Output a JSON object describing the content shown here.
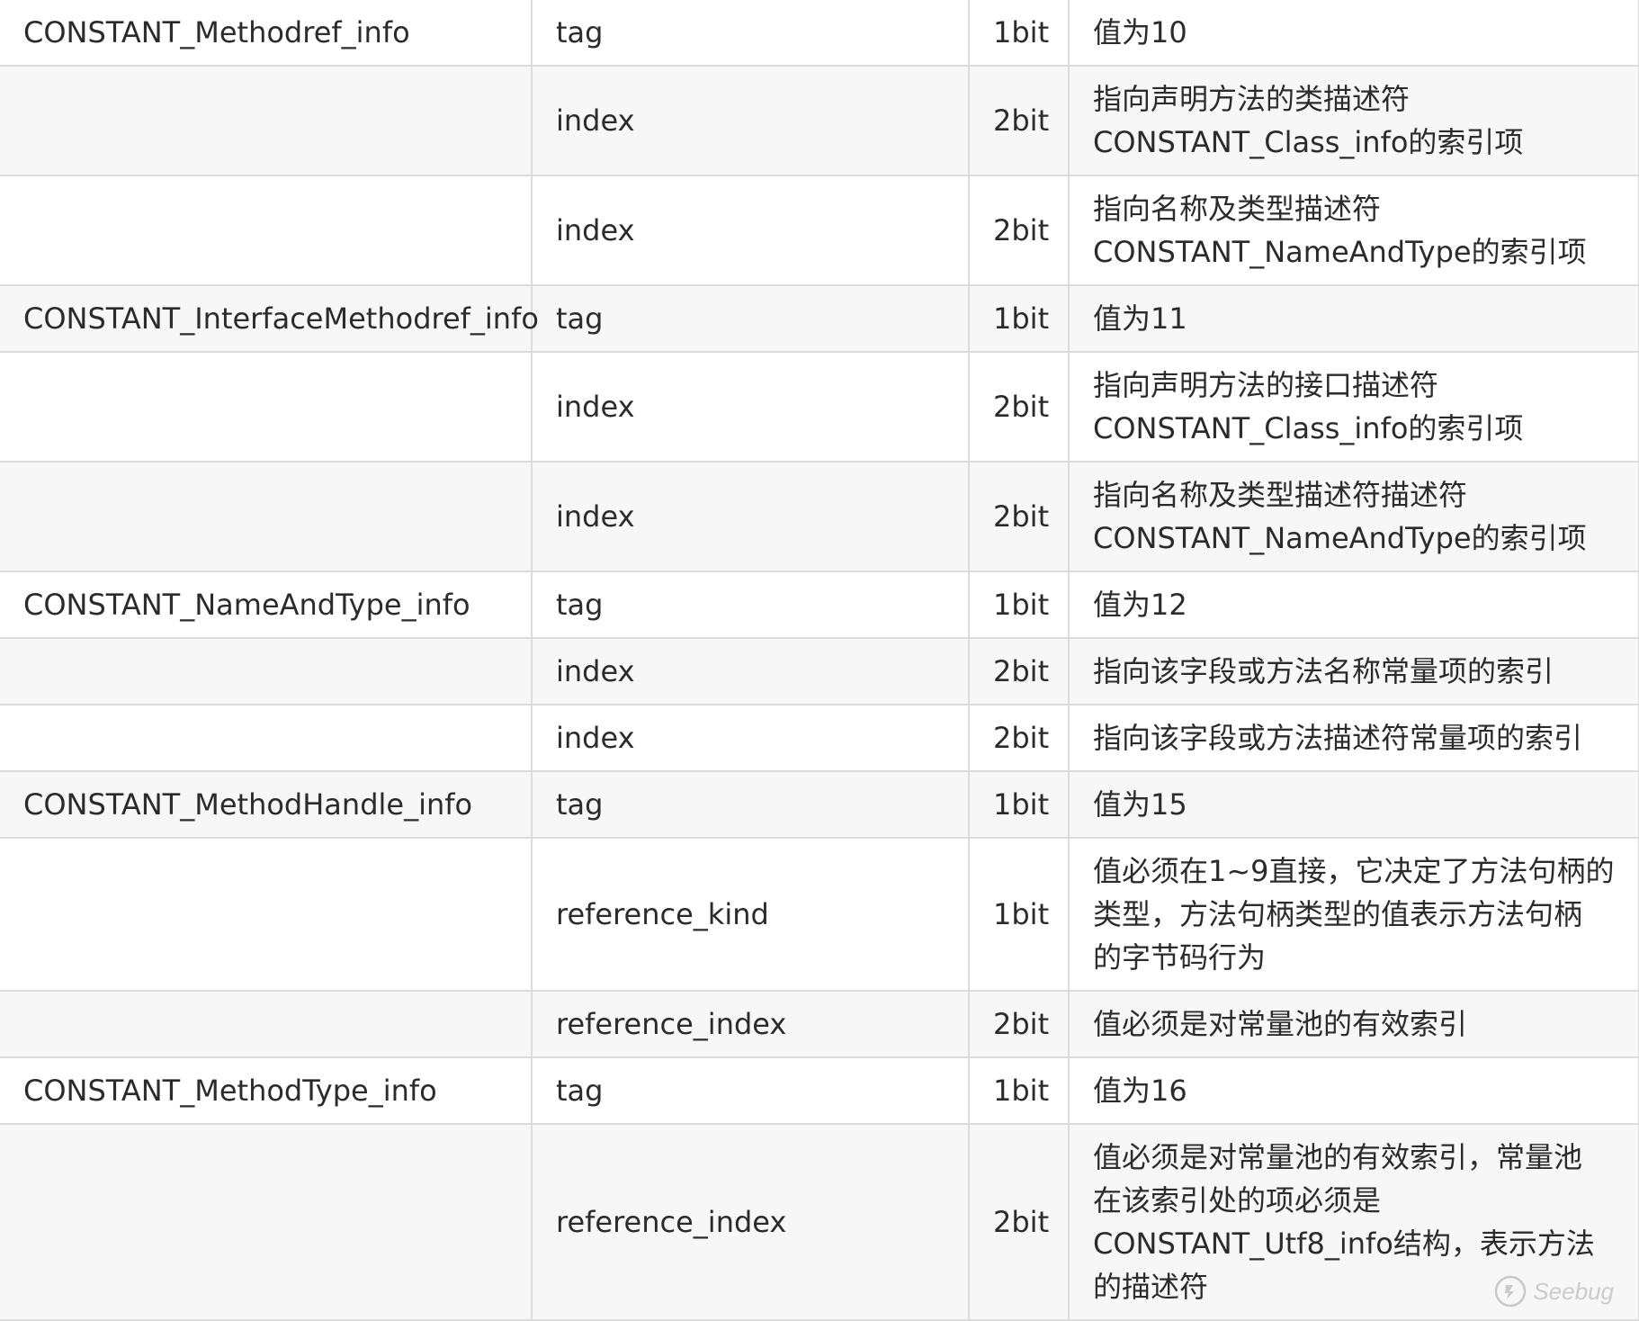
{
  "table": {
    "rows": [
      {
        "name": "CONSTANT_Methodref_info",
        "item": "tag",
        "size": "1bit",
        "desc": "值为10"
      },
      {
        "name": "",
        "item": "index",
        "size": "2bit",
        "desc": "指向声明方法的类描述符\nCONSTANT_Class_info的索引项"
      },
      {
        "name": "",
        "item": "index",
        "size": "2bit",
        "desc": "指向名称及类型描述符\nCONSTANT_NameAndType的索引项"
      },
      {
        "name": "CONSTANT_InterfaceMethodref_info",
        "item": "tag",
        "size": "1bit",
        "desc": "值为11"
      },
      {
        "name": "",
        "item": "index",
        "size": "2bit",
        "desc": "指向声明方法的接口描述符\nCONSTANT_Class_info的索引项"
      },
      {
        "name": "",
        "item": "index",
        "size": "2bit",
        "desc": "指向名称及类型描述符描述符\nCONSTANT_NameAndType的索引项"
      },
      {
        "name": "CONSTANT_NameAndType_info",
        "item": "tag",
        "size": "1bit",
        "desc": "值为12"
      },
      {
        "name": "",
        "item": "index",
        "size": "2bit",
        "desc": "指向该字段或方法名称常量项的索引"
      },
      {
        "name": "",
        "item": "index",
        "size": "2bit",
        "desc": "指向该字段或方法描述符常量项的索引"
      },
      {
        "name": "CONSTANT_MethodHandle_info",
        "item": "tag",
        "size": "1bit",
        "desc": "值为15"
      },
      {
        "name": "",
        "item": "reference_kind",
        "size": "1bit",
        "desc": "值必须在1~9直接，它决定了方法句柄的\n类型，方法句柄类型的值表示方法句柄\n的字节码行为"
      },
      {
        "name": "",
        "item": "reference_index",
        "size": "2bit",
        "desc": "值必须是对常量池的有效索引"
      },
      {
        "name": "CONSTANT_MethodType_info",
        "item": "tag",
        "size": "1bit",
        "desc": "值为16"
      },
      {
        "name": "",
        "item": "reference_index",
        "size": "2bit",
        "desc": "值必须是对常量池的有效索引，常量池\n在该索引处的项必须是\nCONSTANT_Utf8_info结构，表示方法\n的描述符"
      }
    ]
  },
  "watermark": {
    "text": "Seebug",
    "icon": "seebug-logo-icon"
  }
}
